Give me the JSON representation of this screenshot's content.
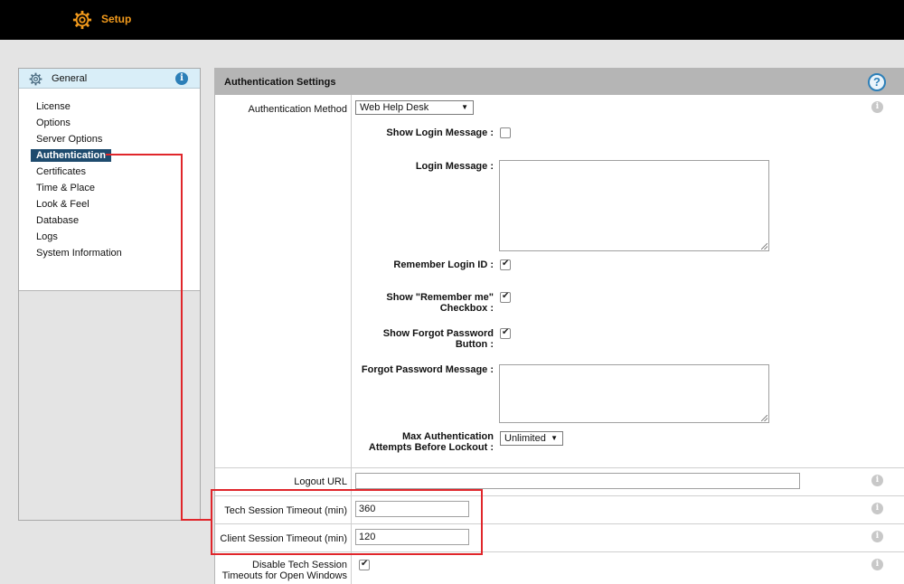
{
  "topbar": {
    "title": "Setup"
  },
  "sidebar": {
    "header": "General",
    "items": [
      {
        "label": "License"
      },
      {
        "label": "Options"
      },
      {
        "label": "Server Options"
      },
      {
        "label": "Authentication",
        "active": true
      },
      {
        "label": "Certificates"
      },
      {
        "label": "Time & Place"
      },
      {
        "label": "Look & Feel"
      },
      {
        "label": "Database"
      },
      {
        "label": "Logs"
      },
      {
        "label": "System Information"
      }
    ]
  },
  "panel": {
    "title": "Authentication Settings",
    "auth_method": {
      "label": "Authentication Method",
      "value": "Web Help Desk"
    },
    "show_login_message": {
      "label": "Show Login Message :",
      "checked": false
    },
    "login_message": {
      "label": "Login Message :",
      "value": ""
    },
    "remember_login": {
      "label": "Remember Login ID :",
      "checked": true
    },
    "show_remember_me": {
      "label_line1": "Show \"Remember me\"",
      "label_line2": "Checkbox :",
      "checked": true
    },
    "show_forgot_password": {
      "label_line1": "Show Forgot Password",
      "label_line2": "Button :",
      "checked": true
    },
    "forgot_password_message": {
      "label": "Forgot Password Message :",
      "value": ""
    },
    "max_auth_attempts": {
      "label_line1": "Max Authentication",
      "label_line2": "Attempts Before Lockout :",
      "value": "Unlimited"
    },
    "logout_url": {
      "label": "Logout URL",
      "value": ""
    },
    "tech_timeout": {
      "label": "Tech Session Timeout (min)",
      "value": "360"
    },
    "client_timeout": {
      "label": "Client Session Timeout (min)",
      "value": "120"
    },
    "disable_tech_timeout": {
      "label_line1": "Disable Tech Session",
      "label_line2": "Timeouts for Open Windows",
      "checked": true
    }
  },
  "colors": {
    "accent": "#f29a1c",
    "active_nav": "#1e4b6e",
    "annotation": "#e0262b",
    "info_blue": "#2c7fb8"
  }
}
